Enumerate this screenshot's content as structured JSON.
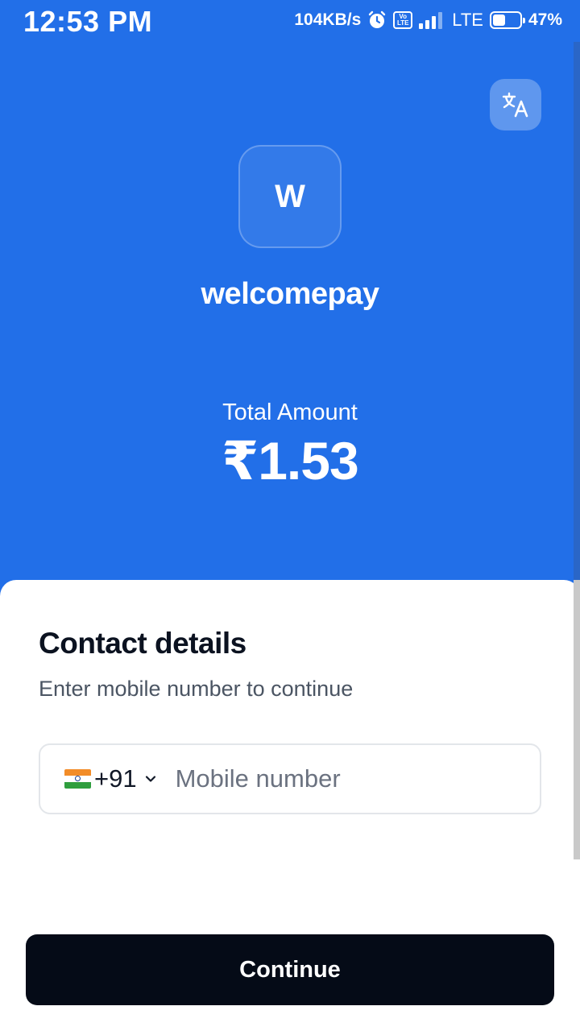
{
  "status_bar": {
    "time": "12:53 PM",
    "network_speed": "104KB/s",
    "volte_label": "Vo LTE",
    "network_type": "LTE",
    "battery_percent": "47%",
    "battery_level": 0.47,
    "icons": [
      "alarm-icon",
      "volte-icon",
      "signal-icon",
      "battery-icon"
    ]
  },
  "header": {
    "translate_icon": "translate-icon",
    "merchant_initial": "W",
    "merchant_name": "welcomepay",
    "amount_label": "Total Amount",
    "amount_value": "₹1.53"
  },
  "contact": {
    "title": "Contact details",
    "subtitle": "Enter mobile number to continue",
    "country_flag": "india-flag-icon",
    "dial_code": "+91",
    "mobile_value": "",
    "mobile_placeholder": "Mobile number"
  },
  "actions": {
    "continue_label": "Continue"
  },
  "colors": {
    "primary_blue": "#226fe8",
    "button_dark": "#050b17",
    "sheet_bg": "#ffffff"
  }
}
